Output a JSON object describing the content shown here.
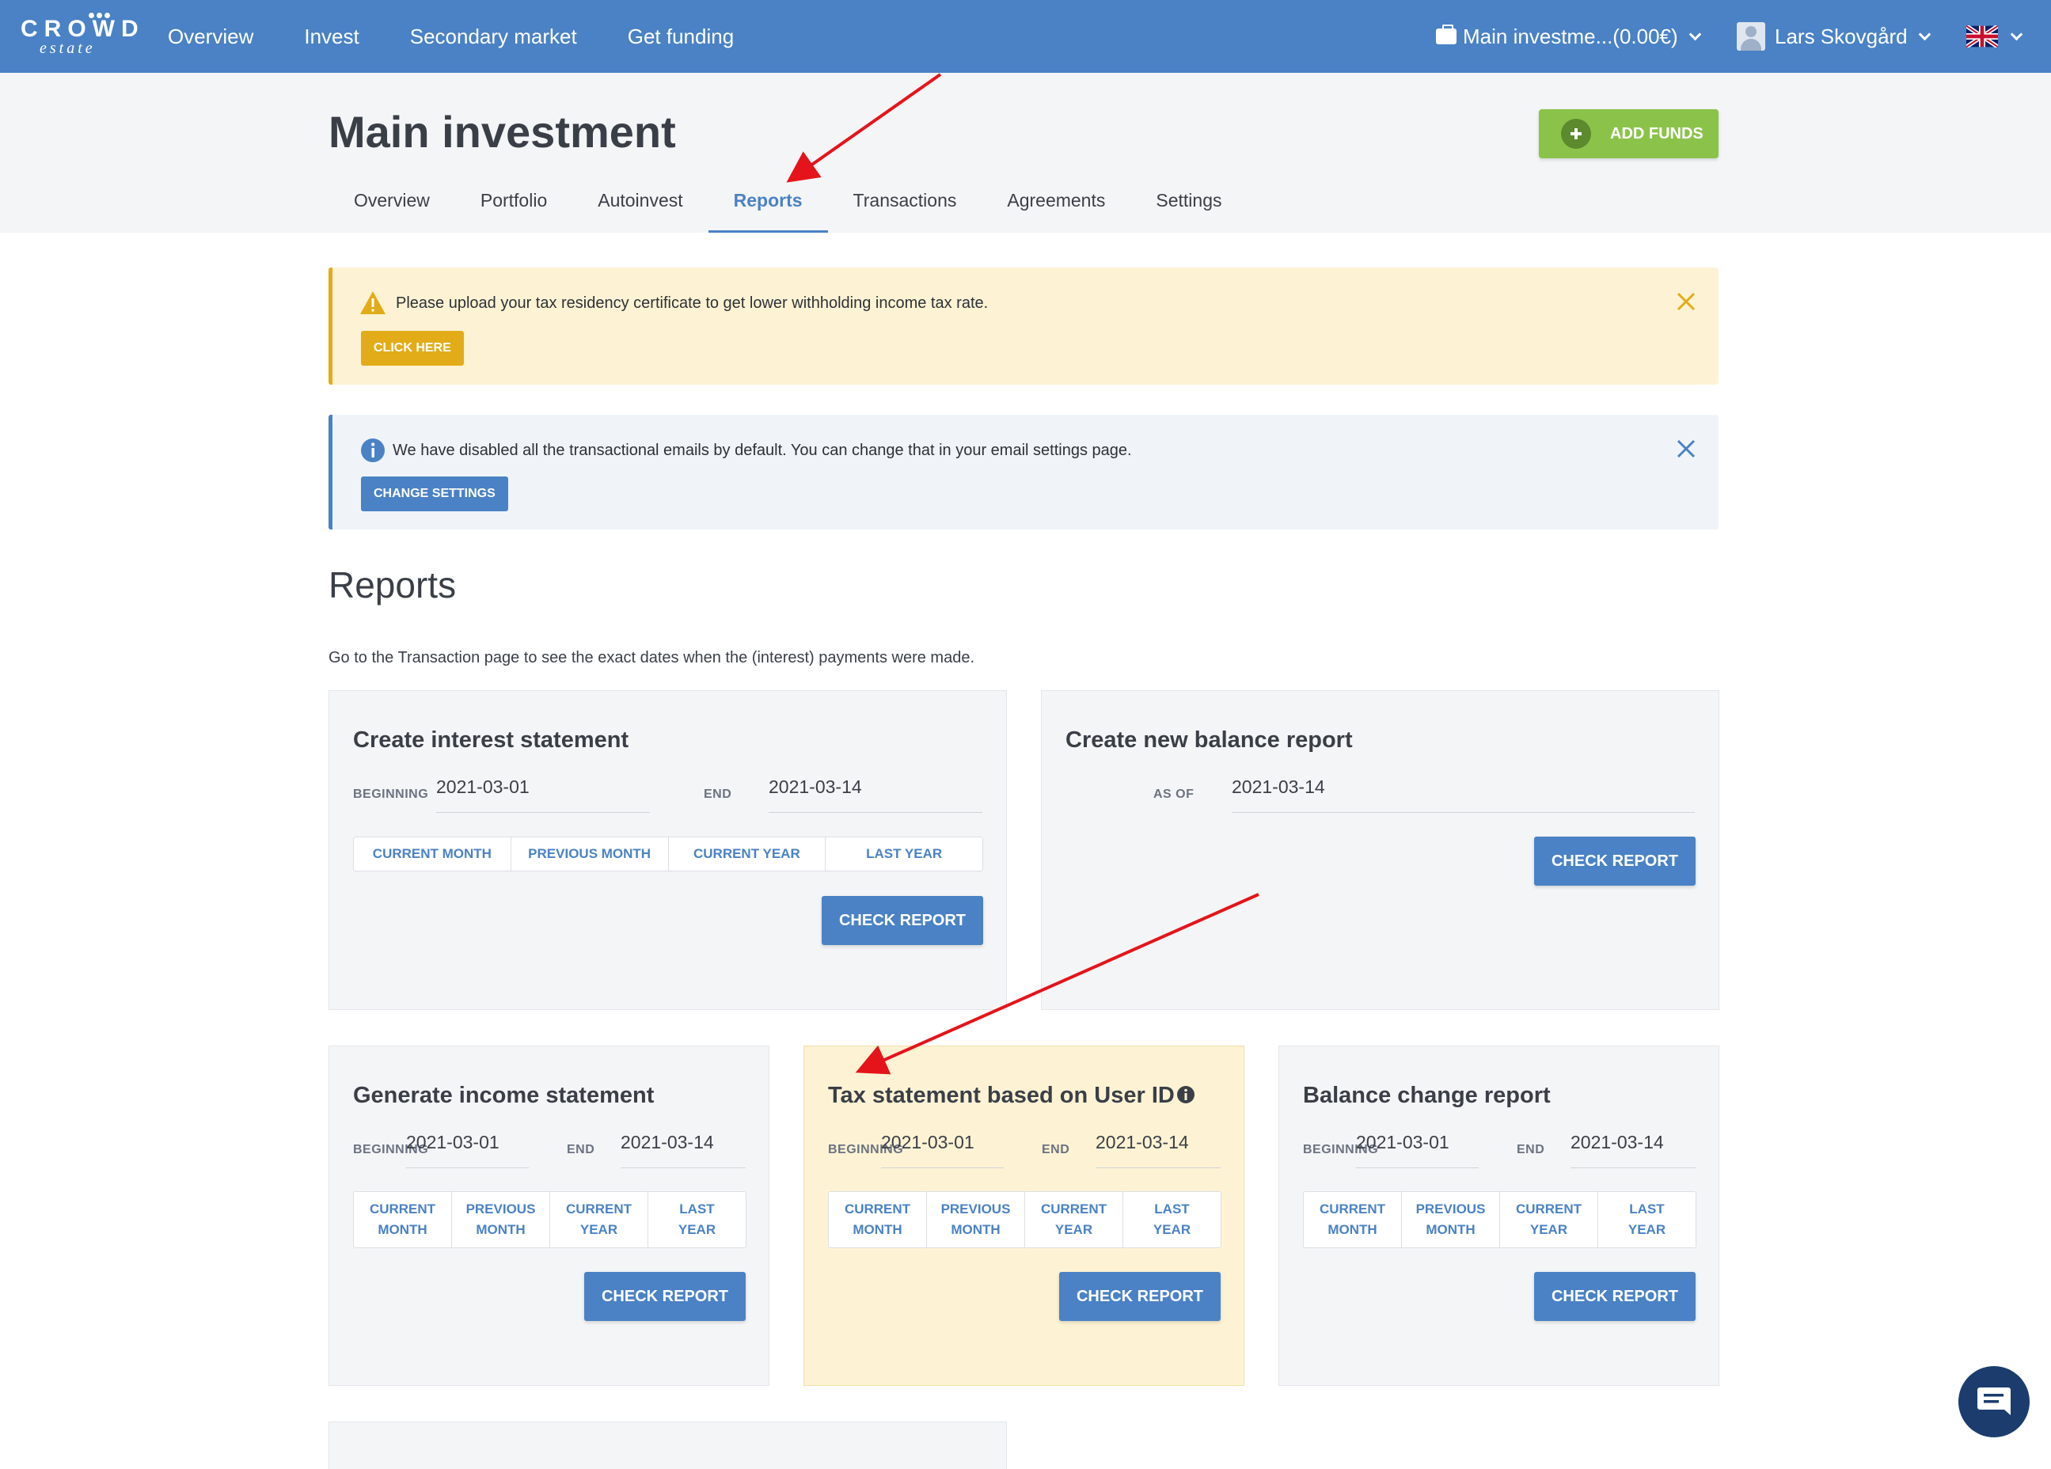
{
  "brand": {
    "logo_top": "CROWD",
    "logo_bottom": "estate"
  },
  "nav": {
    "items": [
      "Overview",
      "Invest",
      "Secondary market",
      "Get funding"
    ]
  },
  "account": {
    "selector": "Main investme...(0.00€)",
    "user": "Lars Skovgård",
    "language_icon": "uk-flag-icon"
  },
  "page": {
    "title": "Main investment",
    "add_funds": "ADD FUNDS"
  },
  "tabs": [
    "Overview",
    "Portfolio",
    "Autoinvest",
    "Reports",
    "Transactions",
    "Agreements",
    "Settings"
  ],
  "active_tab": "Reports",
  "alerts": {
    "tax": {
      "text": "Please upload your tax residency certificate to get lower withholding income tax rate.",
      "button": "CLICK HERE"
    },
    "email": {
      "text": "We have disabled all the transactional emails by default. You can change that in your email settings page.",
      "button": "CHANGE SETTINGS"
    }
  },
  "reports": {
    "heading": "Reports",
    "note": "Go to the Transaction page to see the exact dates when the (interest) payments were made.",
    "interest": {
      "title": "Create interest statement",
      "beginning_label": "BEGINNING",
      "beginning": "2021-03-01",
      "end_label": "END",
      "end": "2021-03-14",
      "presets": [
        "CURRENT MONTH",
        "PREVIOUS MONTH",
        "CURRENT YEAR",
        "LAST YEAR"
      ],
      "button": "CHECK REPORT"
    },
    "balance": {
      "title": "Create new balance report",
      "as_of_label": "AS OF",
      "as_of": "2021-03-14",
      "button": "CHECK REPORT"
    },
    "income": {
      "title": "Generate income statement",
      "beginning_label": "BEGINNING",
      "beginning": "2021-03-01",
      "end_label": "END",
      "end": "2021-03-14",
      "presets": [
        "CURRENT\nMONTH",
        "PREVIOUS\nMONTH",
        "CURRENT\nYEAR",
        "LAST\nYEAR"
      ],
      "button": "CHECK REPORT"
    },
    "tax": {
      "title": "Tax statement based on User ID",
      "beginning_label": "BEGINNING",
      "beginning": "2021-03-01",
      "end_label": "END",
      "end": "2021-03-14",
      "presets": [
        "CURRENT\nMONTH",
        "PREVIOUS\nMONTH",
        "CURRENT\nYEAR",
        "LAST\nYEAR"
      ],
      "button": "CHECK REPORT"
    },
    "balance_change": {
      "title": "Balance change report",
      "beginning_label": "BEGINNING",
      "beginning": "2021-03-01",
      "end_label": "END",
      "end": "2021-03-14",
      "presets": [
        "CURRENT\nMONTH",
        "PREVIOUS\nMONTH",
        "CURRENT\nYEAR",
        "LAST\nYEAR"
      ],
      "button": "CHECK REPORT"
    }
  },
  "colors": {
    "primary": "#4a82c5",
    "warning": "#e2ac19",
    "success": "#8bc34a",
    "annotation_arrow": "#e5141b"
  }
}
